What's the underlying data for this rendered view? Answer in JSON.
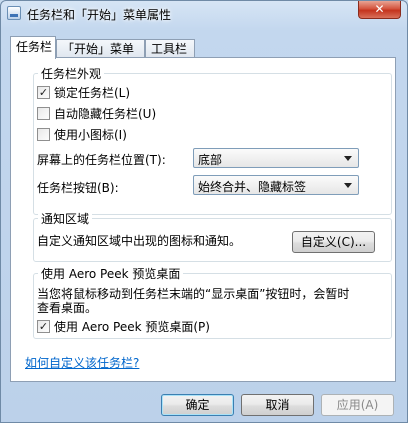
{
  "window": {
    "title": "任务栏和「开始」菜单属性",
    "close_label": "✕"
  },
  "tabs": [
    {
      "label": "任务栏"
    },
    {
      "label": "「开始」菜单"
    },
    {
      "label": "工具栏"
    }
  ],
  "appearance": {
    "title": "任务栏外观",
    "lock_taskbar": {
      "label": "锁定任务栏(L)",
      "checked": true
    },
    "auto_hide": {
      "label": "自动隐藏任务栏(U)",
      "checked": false
    },
    "small_icons": {
      "label": "使用小图标(I)",
      "checked": false
    },
    "location_label": "屏幕上的任务栏位置(T):",
    "location_value": "底部",
    "buttons_label": "任务栏按钮(B):",
    "buttons_value": "始终合并、隐藏标签"
  },
  "notification": {
    "title": "通知区域",
    "text": "自定义通知区域中出现的图标和通知。",
    "customize_label": "自定义(C)..."
  },
  "aero_peek": {
    "title": "使用 Aero Peek 预览桌面",
    "description_line1": "当您将鼠标移动到任务栏末端的“显示桌面”按钮时，会暂时",
    "description_line2": "查看桌面。",
    "use_peek": {
      "label": "使用 Aero Peek 预览桌面(P)",
      "checked": true
    }
  },
  "help_link": "如何自定义该任务栏?",
  "buttons": {
    "ok": "确定",
    "cancel": "取消",
    "apply": "应用(A)"
  }
}
